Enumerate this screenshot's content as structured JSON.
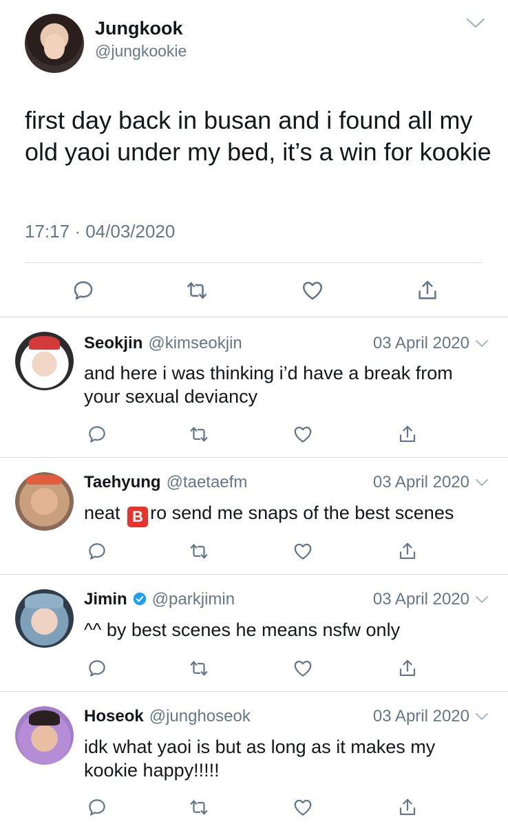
{
  "main_tweet": {
    "author_name": "Jungkook",
    "author_handle": "@jungkookie",
    "text": "first day back in busan and i found all my old yaoi under my bed, it’s a win for kookie",
    "time": "17:17",
    "separator": "·",
    "date": "04/03/2020"
  },
  "replies": [
    {
      "name": "Seokjin",
      "handle": "@kimseokjin",
      "date": "03 April 2020",
      "verified": false,
      "text": "and here i was thinking i’d have a break from your sexual deviancy"
    },
    {
      "name": "Taehyung",
      "handle": "@taetaefm",
      "date": "03 April 2020",
      "verified": false,
      "text_before": "neat",
      "emoji_letter": "B",
      "text_after": "ro send me snaps of the best scenes"
    },
    {
      "name": "Jimin",
      "handle": "@parkjimin",
      "date": "03 April 2020",
      "verified": true,
      "text": "^^ by best scenes he means nsfw only"
    },
    {
      "name": "Hoseok",
      "handle": "@junghoseok",
      "date": "03 April 2020",
      "verified": false,
      "text": "idk what yaoi is but as long as it makes my kookie happy!!!!!"
    }
  ],
  "icons": [
    "reply-icon",
    "retweet-icon",
    "like-icon",
    "share-icon",
    "chevron-down-icon",
    "verified-icon"
  ],
  "colors": {
    "text": "#14171a",
    "secondary": "#657786",
    "verified": "#1da1f2",
    "divider": "#d8dde1"
  }
}
